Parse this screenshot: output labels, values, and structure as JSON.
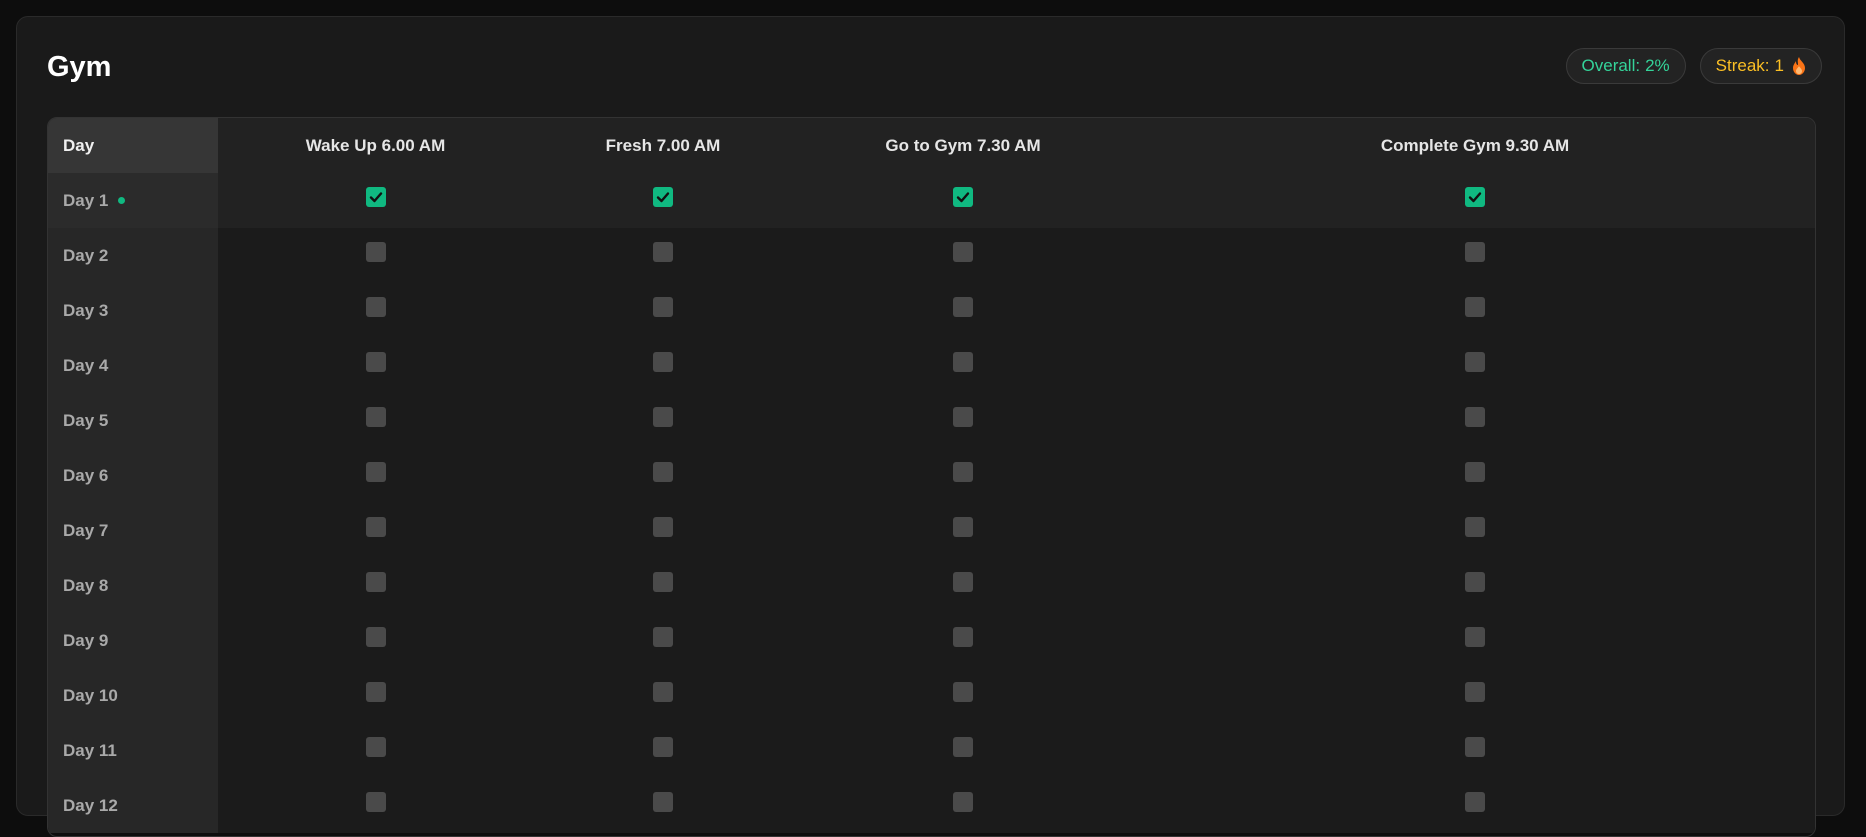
{
  "header": {
    "title": "Gym",
    "overall_label": "Overall:",
    "overall_value": "2%",
    "streak_label": "Streak:",
    "streak_value": "1",
    "streak_icon": "fire-icon"
  },
  "colors": {
    "accent_green": "#10b981",
    "overall_text": "#34d399",
    "streak_text": "#fbbf24",
    "background": "#1a1a1a"
  },
  "table": {
    "day_header": "Day",
    "columns": [
      "Wake Up 6.00 AM",
      "Fresh 7.00 AM",
      "Go to Gym 7.30 AM",
      "Complete Gym 9.30 AM"
    ],
    "rows": [
      {
        "day": "Day 1",
        "current": true,
        "checks": [
          true,
          true,
          true,
          true
        ]
      },
      {
        "day": "Day 2",
        "current": false,
        "checks": [
          false,
          false,
          false,
          false
        ]
      },
      {
        "day": "Day 3",
        "current": false,
        "checks": [
          false,
          false,
          false,
          false
        ]
      },
      {
        "day": "Day 4",
        "current": false,
        "checks": [
          false,
          false,
          false,
          false
        ]
      },
      {
        "day": "Day 5",
        "current": false,
        "checks": [
          false,
          false,
          false,
          false
        ]
      },
      {
        "day": "Day 6",
        "current": false,
        "checks": [
          false,
          false,
          false,
          false
        ]
      },
      {
        "day": "Day 7",
        "current": false,
        "checks": [
          false,
          false,
          false,
          false
        ]
      },
      {
        "day": "Day 8",
        "current": false,
        "checks": [
          false,
          false,
          false,
          false
        ]
      },
      {
        "day": "Day 9",
        "current": false,
        "checks": [
          false,
          false,
          false,
          false
        ]
      },
      {
        "day": "Day 10",
        "current": false,
        "checks": [
          false,
          false,
          false,
          false
        ]
      },
      {
        "day": "Day 11",
        "current": false,
        "checks": [
          false,
          false,
          false,
          false
        ]
      },
      {
        "day": "Day 12",
        "current": false,
        "checks": [
          false,
          false,
          false,
          false
        ]
      }
    ]
  }
}
